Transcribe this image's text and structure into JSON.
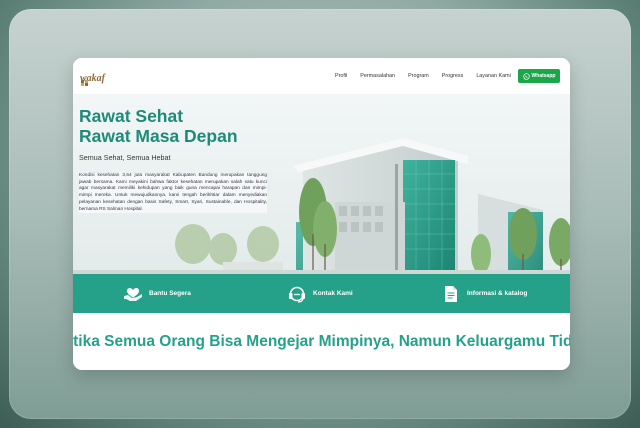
{
  "nav": {
    "logo": "wakaf",
    "links": [
      "Profil",
      "Permasalahan",
      "Program",
      "Progress",
      "Layanan Kami"
    ],
    "whatsapp_label": "Whatsapp",
    "icons": {
      "whatsapp": "whatsapp-icon"
    }
  },
  "hero": {
    "title_line1": "Rawat Sehat",
    "title_line2": "Rawat Masa Depan",
    "subtitle": "Semua Sehat, Semua Hebat",
    "paragraph": "Kondisi kesehatan 3,64 juta masyarakat Kabupaten Bandung merupakan tanggung jawab bersama. Kami meyakini bahwa faktor kesehatan merupakan salah satu kunci agar masyarakat memiliki kehidupan yang baik guna mencapai harapan dan mimpi-mimpi mereka. Untuk mewujudkannya, kami tengah berikhtiar dalam menyediakan pelayanan kesehatan dengan basis Safety, Smart, Syari, Sustainable, dan Hospitality, bernama RS Salman Hospital."
  },
  "actions": [
    {
      "label": "Bantu Segera",
      "icon": "heart-hands-icon"
    },
    {
      "label": "Kontak Kami",
      "icon": "headset-icon"
    },
    {
      "label": "Informasi & katalog",
      "icon": "document-icon"
    }
  ],
  "tagline": "Ketika Semua Orang Bisa Mengejar Mimpinya, Namun Keluargamu Tidak",
  "colors": {
    "primary": "#25a18a",
    "title": "#1f8a78",
    "whatsapp": "#1aa74a"
  }
}
